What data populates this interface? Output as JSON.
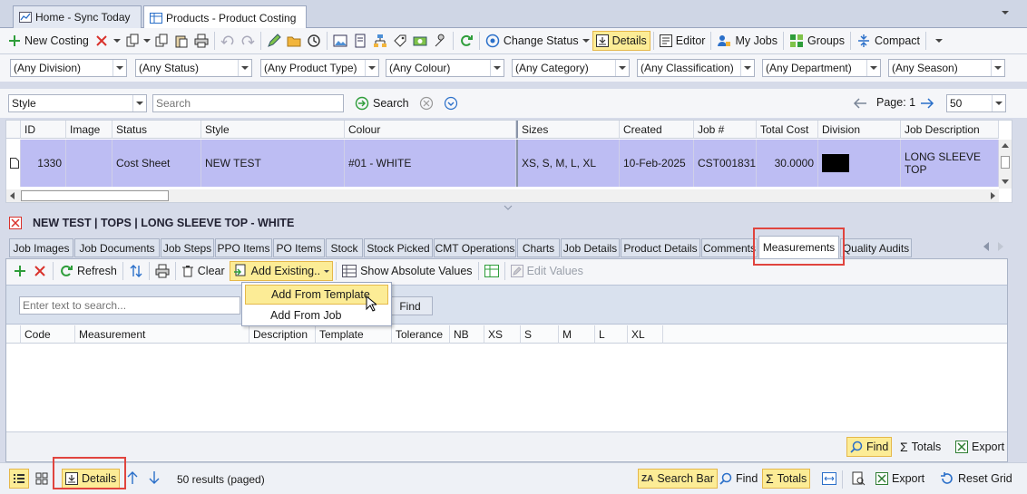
{
  "doc_tabs": [
    {
      "label": "Home - Sync Today"
    },
    {
      "label": "Products - Product Costing"
    }
  ],
  "ribbon": {
    "new_costing": "New Costing",
    "change_status": "Change Status",
    "details": "Details",
    "editor": "Editor",
    "my_jobs": "My Jobs",
    "groups": "Groups",
    "compact": "Compact"
  },
  "filters": [
    "(Any Division)",
    "(Any Status)",
    "(Any Product Type)",
    "(Any Colour)",
    "(Any Category)",
    "(Any Classification)",
    "(Any Department)",
    "(Any Season)"
  ],
  "search": {
    "field": "Style",
    "placeholder": "Search",
    "button": "Search",
    "page_label": "Page: 1",
    "page_size": "50"
  },
  "grid": {
    "columns": [
      "ID",
      "Image",
      "Status",
      "Style",
      "Colour",
      "Sizes",
      "Created",
      "Job #",
      "Total Cost",
      "Division",
      "Job Description"
    ],
    "row": {
      "id": "1330",
      "status": "Cost Sheet",
      "style": "NEW TEST",
      "colour": "#01 - WHITE",
      "sizes": "XS, S, M, L, XL",
      "created": "10-Feb-2025",
      "job": "CST001831",
      "total_cost": "30.0000",
      "job_description": "LONG SLEEVE TOP"
    }
  },
  "detail": {
    "title": "NEW TEST | TOPS | LONG SLEEVE TOP - WHITE",
    "tabs": [
      "Job Images",
      "Job Documents",
      "Job Steps",
      "PPO Items",
      "PO Items",
      "Stock",
      "Stock Picked",
      "CMT Operations",
      "Charts",
      "Job Details",
      "Product Details",
      "Comments",
      "Measurements",
      "Quality Audits"
    ],
    "toolbar": {
      "refresh": "Refresh",
      "clear": "Clear",
      "add_existing": "Add Existing..",
      "show_absolute": "Show Absolute Values",
      "edit_values": "Edit Values"
    },
    "find_placeholder": "Enter text to search...",
    "find_button": "Find",
    "columns": [
      "Code",
      "Measurement",
      "Description",
      "Template",
      "Tolerance",
      "NB",
      "XS",
      "S",
      "M",
      "L",
      "XL"
    ],
    "menu": [
      "Add From Template",
      "Add From Job"
    ],
    "footer": {
      "find": "Find",
      "totals": "Totals",
      "export": "Export"
    }
  },
  "status": {
    "details": "Details",
    "results": "50 results (paged)",
    "search_bar": "Search Bar",
    "find": "Find",
    "totals": "Totals",
    "export": "Export",
    "reset_grid": "Reset Grid"
  },
  "colors": {
    "accent": "#fcec96",
    "selected_row": "#bdbdf3",
    "highlight_box": "#e0443e"
  }
}
